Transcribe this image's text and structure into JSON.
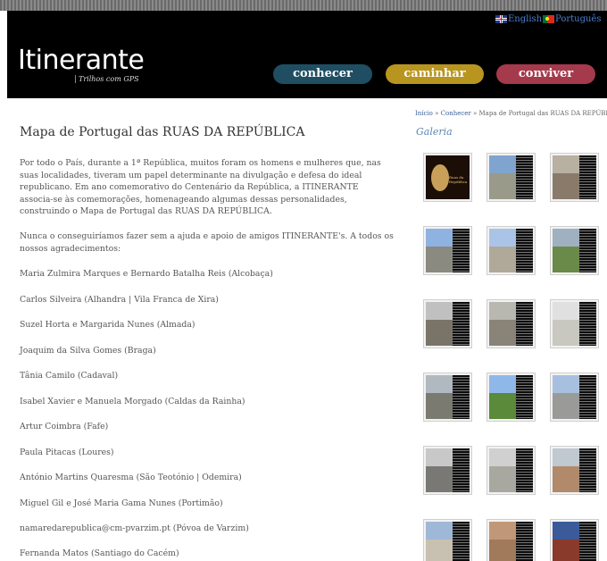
{
  "header": {
    "logo": "Itinerante",
    "tagline": "Trilhos com GPS",
    "languages": [
      {
        "label": "English",
        "flag": "uk-flag-icon"
      },
      {
        "label": "Português",
        "flag": "pt-flag-icon"
      }
    ],
    "nav": [
      {
        "label": "conhecer",
        "color": "#1f4e63"
      },
      {
        "label": "caminhar",
        "color": "#b8951f"
      },
      {
        "label": "conviver",
        "color": "#a53a4c"
      }
    ]
  },
  "breadcrumb": {
    "home": "Início",
    "sep": " » ",
    "section": "Conhecer",
    "current": "Mapa de Portugal das RUAS DA REPÚBLICA"
  },
  "main": {
    "title": "Mapa de Portugal das RUAS DA REPÚBLICA",
    "paragraphs": [
      "Por todo o País, durante a 1ª República, muitos foram os homens e mulheres que, nas suas localidades, tiveram um papel determinante na divulgação e defesa do ideal republicano. Em ano comemorativo do Centenário da República, a ITINERANTE associa-se às comemorações, homenageando algumas dessas personalidades, construindo o Mapa de Portugal das RUAS DA REPÚBLICA.",
      "Nunca o conseguiríamos fazer sem a ajuda e apoio de amigos ITINERANTE's. A todos os nossos agradecimentos:"
    ],
    "thanks": [
      "Maria Zulmira Marques e Bernardo Batalha Reis (Alcobaça)",
      "Carlos Silveira (Alhandra | Vila Franca de Xira)",
      "Suzel Horta e Margarida Nunes (Almada)",
      "Joaquim da Silva Gomes (Braga)",
      "Tânia Camilo (Cadaval)",
      "Isabel Xavier e Manuela Morgado (Caldas da Rainha)",
      "Artur Coimbra (Fafe)",
      "Paula Pitacas (Loures)",
      "António Martins Quaresma (São Teotónio | Odemira)",
      "Miguel Gil e José Maria Gama Nunes (Portimão)",
      "namaredarepublica@cm-pvarzim.pt (Póvoa de Varzim)",
      "Fernanda Matos (Santiago do Cacém)"
    ]
  },
  "gallery": {
    "title": "Galeria",
    "first_thumb_text": "Ruas da República",
    "thumbs": [
      {
        "photo": "#c9a05a",
        "sky": "#8a5a2a"
      },
      {
        "photo": "#9a9a8a",
        "sky": "#7fa4cf"
      },
      {
        "photo": "#8a7a6a",
        "sky": "#b8b0a0"
      },
      {
        "photo": "#8a8a80",
        "sky": "#8fb3e0"
      },
      {
        "photo": "#b0a898",
        "sky": "#a9c4e6"
      },
      {
        "photo": "#6a8a4a",
        "sky": "#9fb0c0"
      },
      {
        "photo": "#7a7468",
        "sky": "#c0c0c0"
      },
      {
        "photo": "#8a8478",
        "sky": "#b8b8b0"
      },
      {
        "photo": "#c8c8c0",
        "sky": "#e0e0e0"
      },
      {
        "photo": "#7a7a70",
        "sky": "#b0b8c0"
      },
      {
        "photo": "#5a8a3a",
        "sky": "#8fb8e8"
      },
      {
        "photo": "#9a9a98",
        "sky": "#a8c0e0"
      },
      {
        "photo": "#7a7874",
        "sky": "#c8c8c8"
      },
      {
        "photo": "#a8a8a0",
        "sky": "#d0d0d0"
      },
      {
        "photo": "#b08a6a",
        "sky": "#c0c8d0"
      },
      {
        "photo": "#c8c0b0",
        "sky": "#9fb8d8"
      },
      {
        "photo": "#a07a5a",
        "sky": "#c09878"
      },
      {
        "photo": "#8a3a2a",
        "sky": "#3a5a9a"
      }
    ]
  }
}
